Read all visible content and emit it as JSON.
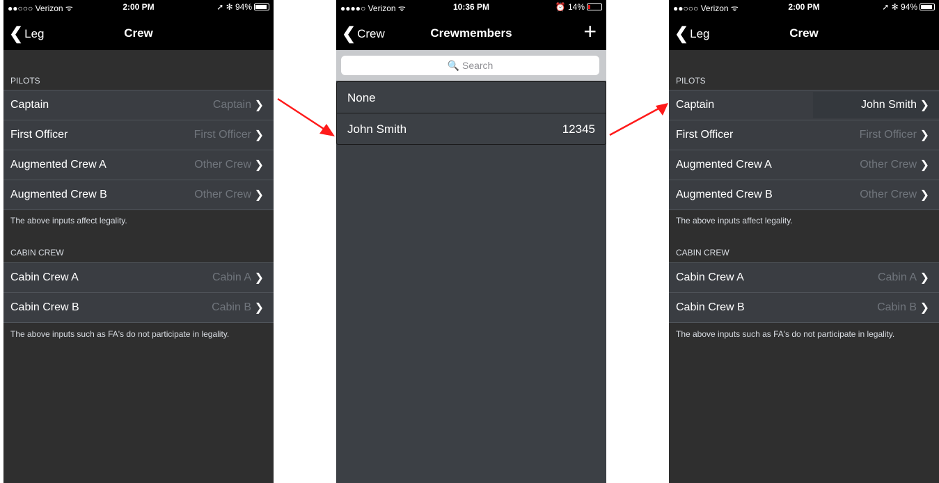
{
  "screen1": {
    "status": {
      "carrier": "●●○○○ Verizon ᯤ",
      "time": "2:00 PM",
      "right": "➚ ✻ 94%"
    },
    "nav": {
      "back": "Leg",
      "title": "Crew"
    },
    "pilots_header": "PILOTS",
    "pilots": [
      {
        "label": "Captain",
        "value": "Captain"
      },
      {
        "label": "First Officer",
        "value": "First Officer"
      },
      {
        "label": "Augmented Crew A",
        "value": "Other Crew"
      },
      {
        "label": "Augmented Crew B",
        "value": "Other Crew"
      }
    ],
    "pilots_footer": "The above inputs affect legality.",
    "cabin_header": "CABIN CREW",
    "cabin": [
      {
        "label": "Cabin Crew A",
        "value": "Cabin A"
      },
      {
        "label": "Cabin Crew B",
        "value": "Cabin B"
      }
    ],
    "cabin_footer": "The above inputs such as FA's do not participate in legality."
  },
  "screen2": {
    "status": {
      "carrier": "●●●●○ Verizon ᯤ",
      "time": "10:36 PM",
      "right": "⏰ 14%"
    },
    "nav": {
      "back": "Crew",
      "title": "Crewmembers",
      "add": "+"
    },
    "search_placeholder": "🔍 Search",
    "items": [
      {
        "name": "None",
        "number": ""
      },
      {
        "name": "John Smith",
        "number": "12345"
      }
    ]
  },
  "screen3": {
    "status": {
      "carrier": "●●○○○ Verizon ᯤ",
      "time": "2:00 PM",
      "right": "➚ ✻ 94%"
    },
    "nav": {
      "back": "Leg",
      "title": "Crew"
    },
    "pilots_header": "PILOTS",
    "pilots": [
      {
        "label": "Captain",
        "value": "John Smith"
      },
      {
        "label": "First Officer",
        "value": "First Officer"
      },
      {
        "label": "Augmented Crew A",
        "value": "Other Crew"
      },
      {
        "label": "Augmented Crew B",
        "value": "Other Crew"
      }
    ],
    "pilots_footer": "The above inputs affect legality.",
    "cabin_header": "CABIN CREW",
    "cabin": [
      {
        "label": "Cabin Crew A",
        "value": "Cabin A"
      },
      {
        "label": "Cabin Crew B",
        "value": "Cabin B"
      }
    ],
    "cabin_footer": "The above inputs such as FA's do not participate in legality."
  },
  "icons": {
    "back": "chevron-left-icon",
    "disclosure": "chevron-right-icon",
    "arrow": "red-arrow"
  },
  "colors": {
    "arrow": "#ff1a1a",
    "nav_bg": "#000000",
    "screen_bg": "#2f2f2f",
    "row_bg": "#3a3d42"
  }
}
